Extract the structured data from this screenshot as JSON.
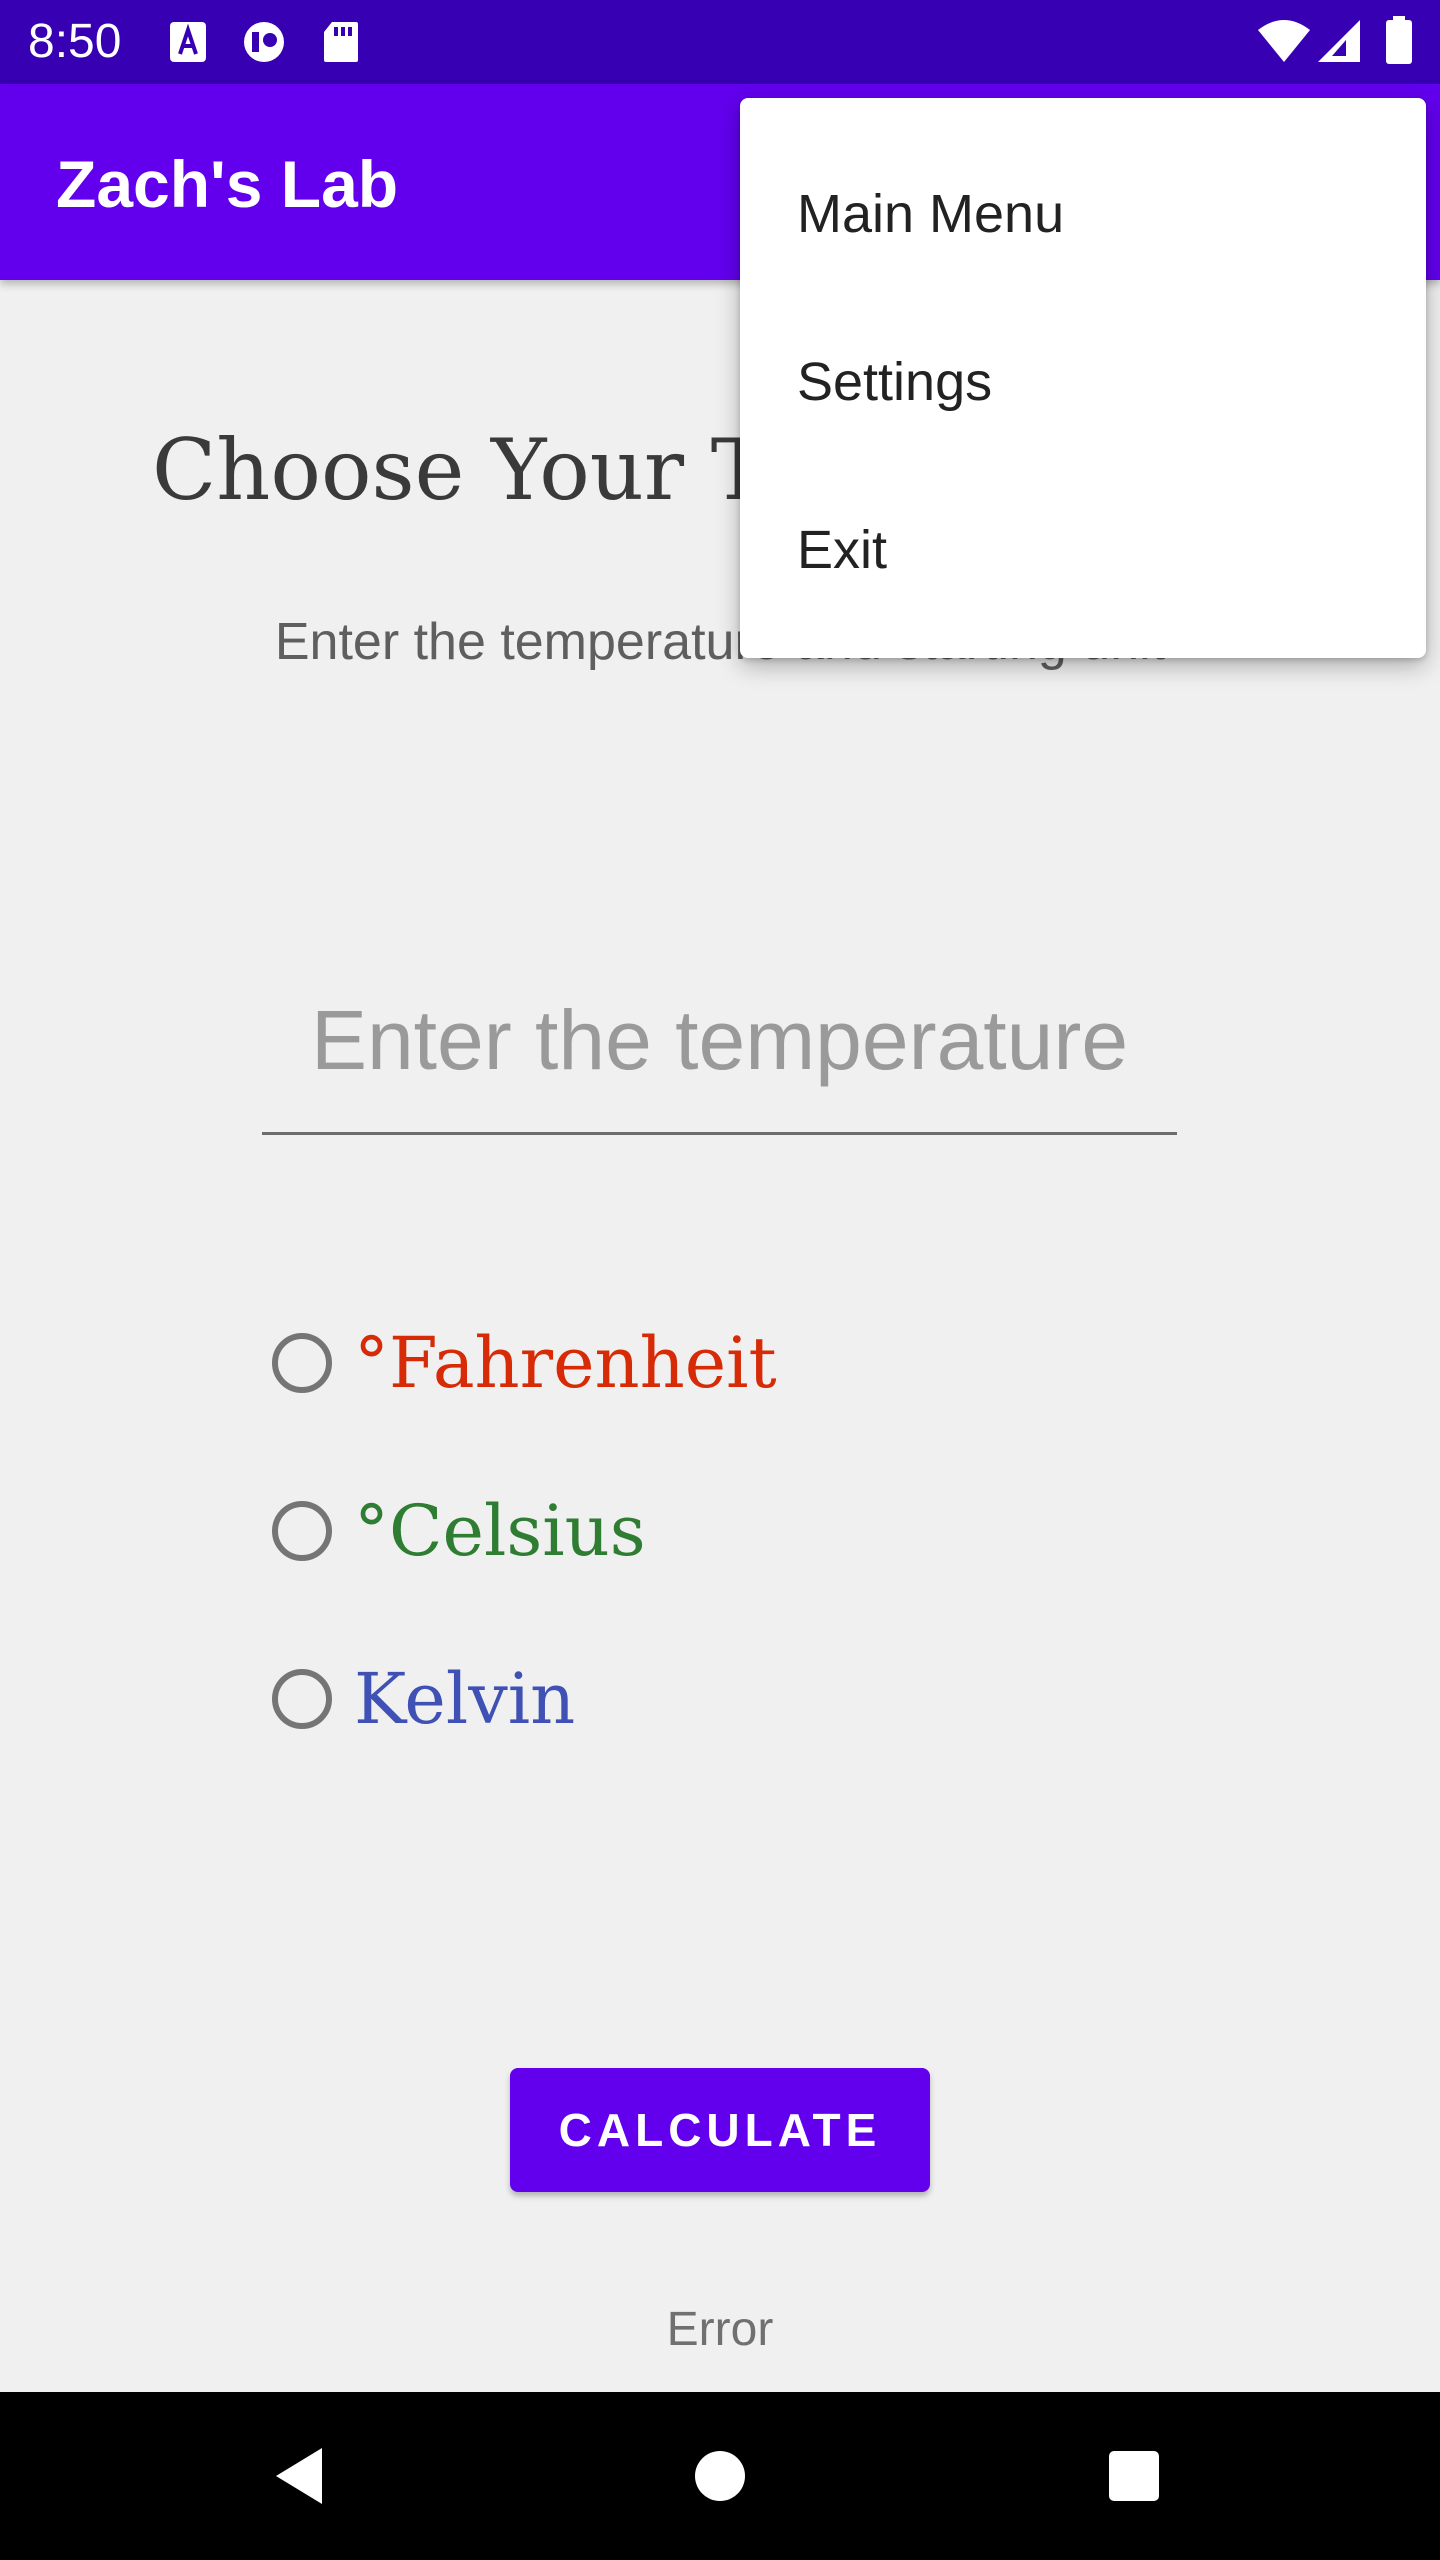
{
  "status_bar": {
    "time": "8:50",
    "left_icons": [
      "a-notification-icon",
      "vpn-key-icon",
      "sd-card-icon"
    ],
    "right_icons": [
      "wifi-icon",
      "signal-icon",
      "battery-icon"
    ]
  },
  "app_bar": {
    "title": "Zach's Lab"
  },
  "main": {
    "heading": "Choose Your T",
    "subheading": "Enter the temperature and starting unit",
    "temperature_input": {
      "value": "",
      "placeholder": "Enter the temperature"
    },
    "units": [
      {
        "label": "°Fahrenheit",
        "color": "#d62b06",
        "selected": false
      },
      {
        "label": "°Celsius",
        "color": "#2e7d32",
        "selected": false
      },
      {
        "label": "Kelvin",
        "color": "#3f51b5",
        "selected": false
      }
    ],
    "calculate_label": "CALCULATE",
    "result_text": "Error"
  },
  "overflow_menu": {
    "items": [
      {
        "label": "Main Menu"
      },
      {
        "label": "Settings"
      },
      {
        "label": "Exit"
      }
    ]
  },
  "nav_bar": {
    "buttons": [
      "back-icon",
      "home-icon",
      "recents-icon"
    ]
  },
  "colors": {
    "status_bar": "#3700b3",
    "primary": "#6200ee",
    "background": "#f0f0f0"
  }
}
